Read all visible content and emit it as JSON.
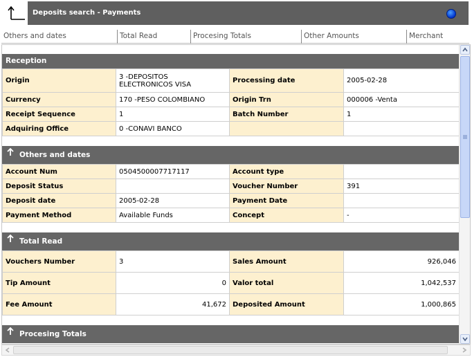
{
  "window": {
    "title": "Deposits search - Payments"
  },
  "tabs": [
    "Others and dates",
    "Total Read",
    "Procesing Totals",
    "Other Amounts",
    "Merchant"
  ],
  "icons": {
    "back": "back-arrow-icon",
    "status": "blue-status-dot-icon",
    "collapse": "arrow-up-icon"
  },
  "reception": {
    "title": "Reception",
    "origin_label": "Origin",
    "origin_value_line1": "3 -DEPOSITOS",
    "origin_value_line2": "ELECTRONICOS VISA",
    "processing_date_label": "Processing date",
    "processing_date_value": "2005-02-28",
    "currency_label": "Currency",
    "currency_value": "170 -PESO COLOMBIANO",
    "origin_trn_label": "Origin Trn",
    "origin_trn_value": "000006 -Venta",
    "receipt_seq_label": "Receipt Sequence",
    "receipt_seq_value": "1",
    "batch_number_label": "Batch Number",
    "batch_number_value": "1",
    "adquiring_office_label": "Adquiring Office",
    "adquiring_office_value": "0 -CONAVI BANCO"
  },
  "others_dates": {
    "title": "Others and dates",
    "account_num_label": "Account Num",
    "account_num_value": "0504500007717117",
    "account_type_label": "Account type",
    "account_type_value": "",
    "deposit_status_label": "Deposit Status",
    "deposit_status_value": "",
    "voucher_number_label": "Voucher Number",
    "voucher_number_value": "391",
    "deposit_date_label": "Deposit date",
    "deposit_date_value": "2005-02-28",
    "payment_date_label": "Payment Date",
    "payment_date_value": "",
    "payment_method_label": "Payment Method",
    "payment_method_value": "Available Funds",
    "concept_label": "Concept",
    "concept_value": "-"
  },
  "total_read": {
    "title": "Total Read",
    "vouchers_number_label": "Vouchers Number",
    "vouchers_number_value": "3",
    "sales_amount_label": "Sales Amount",
    "sales_amount_value": "926,046",
    "tip_amount_label": "Tip Amount",
    "tip_amount_value": "0",
    "valor_total_label": "Valor total",
    "valor_total_value": "1,042,537",
    "fee_amount_label": "Fee Amount",
    "fee_amount_value": "41,672",
    "deposited_amount_label": "Deposited Amount",
    "deposited_amount_value": "1,000,865"
  },
  "procesing_totals": {
    "title": "Procesing Totals"
  }
}
